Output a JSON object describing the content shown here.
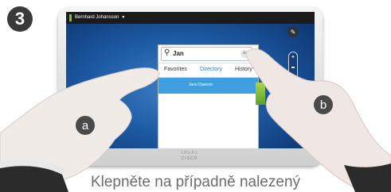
{
  "step_number": "3",
  "device": {
    "user_name": "Bernhard Johansson",
    "search_value": "Jan",
    "tabs": [
      {
        "label": "Favorites",
        "active": false
      },
      {
        "label": "Directory",
        "active": true
      },
      {
        "label": "History",
        "active": false
      }
    ],
    "result": "Jane Dawson",
    "brand": "CISCO"
  },
  "callouts": {
    "a": "a",
    "b": "b"
  },
  "caption": "Klepněte na případně nalezený",
  "colors": {
    "accent": "#2e7fc4",
    "selection": "#3e9fe0",
    "screen": "#1d5aa4"
  }
}
